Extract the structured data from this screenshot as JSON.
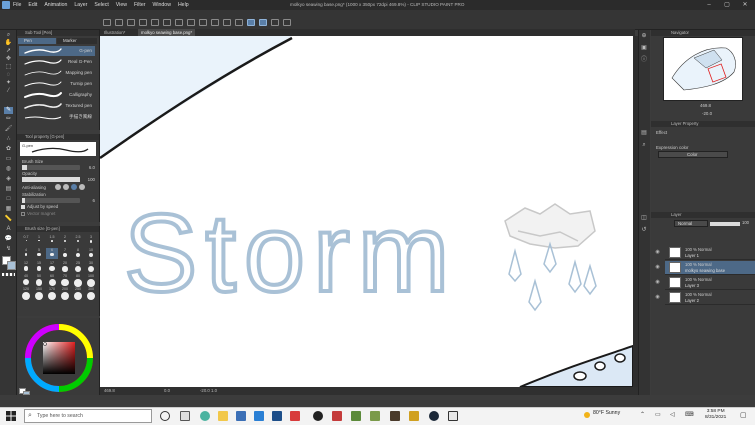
{
  "app": {
    "menu": [
      "File",
      "Edit",
      "Animation",
      "Layer",
      "Select",
      "View",
      "Filter",
      "Window",
      "Help"
    ],
    "document_title": "molkyo seawing base.png* (1000 x 350px 72dpi 469.8%) - CLIP STUDIO PAINT PRO",
    "window_controls": [
      "–",
      "▢",
      "✕"
    ]
  },
  "tabs": [
    {
      "label": "Illustration*"
    },
    {
      "label": "molkyo seawing base.png*"
    }
  ],
  "subtool": {
    "panel_title": "Sub Tool [Pen]",
    "tab_pen": "Pen",
    "tab_marker": "Marker",
    "brushes": [
      "G-pen",
      "Real G-Pen",
      "Mapping pen",
      "Turnip pen",
      "Calligraphy",
      "Textured pen",
      "手描き風線"
    ],
    "selected_index": 0
  },
  "tool_property": {
    "panel_title": "Tool property [G-pen]",
    "brush_name": "G-pen",
    "brush_size_label": "Brush Size",
    "brush_size_value": "6.0",
    "opacity_label": "Opacity",
    "opacity_value": "100",
    "antialiasing_label": "Anti-aliasing",
    "stabilization_label": "Stabilization",
    "stabilization_value": "6",
    "adjust_by_speed": "Adjust by speed",
    "vector_magnet": "Vector magnet"
  },
  "brush_size_panel": {
    "panel_title": "Brush size [G-pen]",
    "sizes": [
      "0.7",
      "1",
      "1.5",
      "2",
      "2.5",
      "3",
      "4",
      "5",
      "6",
      "7",
      "8",
      "10",
      "12",
      "15",
      "17",
      "20",
      "25",
      "30",
      "40",
      "50",
      "60",
      "70",
      "80",
      "100",
      "120",
      "150",
      "170",
      "200",
      "250",
      "300"
    ]
  },
  "canvas": {
    "text": "Storm",
    "text_color": "#a9c1d6"
  },
  "status": {
    "zoom": "469.8",
    "angle": "0.0",
    "position": "-20.0 1.0"
  },
  "navigator": {
    "title": "Navigator",
    "zoom": "469.8",
    "angle": "-20.0"
  },
  "layer_property": {
    "title": "Layer Property",
    "effect_label": "Effect",
    "expression_color_label": "Expression color",
    "expression_color_value": "Color"
  },
  "layer_panel": {
    "title": "Layer",
    "blend_mode": "Normal",
    "opacity": "100",
    "layers": [
      {
        "line1": "100 % Normal",
        "line2": "Layer 1"
      },
      {
        "line1": "100 % Normal",
        "line2": "molkyo seawing base"
      },
      {
        "line1": "100 % Normal",
        "line2": "Layer 3"
      },
      {
        "line1": "100 % Normal",
        "line2": "Layer 2"
      }
    ],
    "selected_index": 1
  },
  "taskbar": {
    "search_placeholder": "Type here to search",
    "weather": "80°F  Sunny",
    "time": "3:58 PM",
    "date": "8/31/2021"
  },
  "colors": {
    "accent": "#4d6987",
    "ui_dark": "#3a3a3a",
    "sky_fill": "#eaf3fb",
    "canvas_line": "#1a1a1a"
  }
}
